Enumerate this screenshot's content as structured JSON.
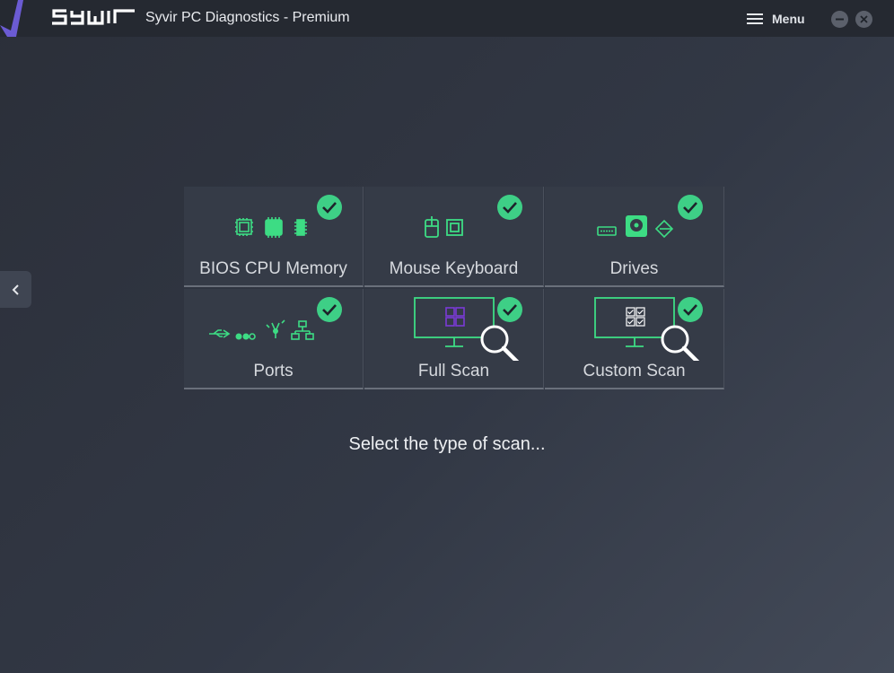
{
  "titlebar": {
    "logo_text": "SYWIR",
    "title": "Syvir PC Diagnostics - Premium",
    "menu_label": "Menu"
  },
  "tiles": [
    {
      "label": "BIOS CPU Memory",
      "status": "checked"
    },
    {
      "label": "Mouse Keyboard",
      "status": "checked"
    },
    {
      "label": "Drives",
      "status": "checked"
    },
    {
      "label": "Ports",
      "status": "checked"
    },
    {
      "label": "Full Scan",
      "status": "checked"
    },
    {
      "label": "Custom Scan",
      "status": "checked"
    }
  ],
  "prompt": "Select the type of scan...",
  "colors": {
    "accent_green": "#3ddc84",
    "check_green": "#3ecf86",
    "purple": "#7a3bd6",
    "background": "#323845",
    "titlebar": "#252931"
  },
  "icons": {
    "menu": "hamburger-icon",
    "minimize": "minimize-icon",
    "close": "close-icon",
    "back": "chevron-left-icon"
  }
}
